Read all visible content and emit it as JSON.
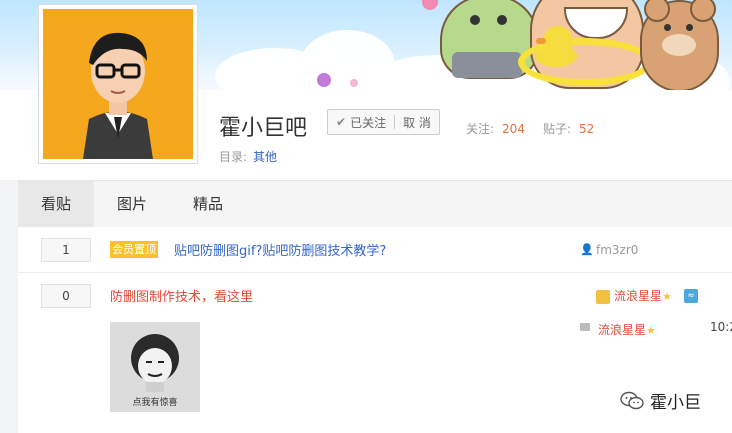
{
  "forum": {
    "name": "霍小巨吧",
    "follow_label": "已关注",
    "unfollow_label": "取 消",
    "followers_label": "关注:",
    "followers_count": "204",
    "posts_label": "贴子:",
    "posts_count": "52",
    "catalog_label": "目录:",
    "catalog_value": "其他"
  },
  "tabs": [
    {
      "label": "看贴",
      "active": true
    },
    {
      "label": "图片",
      "active": false
    },
    {
      "label": "精品",
      "active": false
    }
  ],
  "threads": [
    {
      "reply_count": "1",
      "badge": "会员置顶",
      "title": "贴吧防删图gif?贴吧防删图技术教学?",
      "author": "fm3zr0"
    },
    {
      "reply_count": "0",
      "title": "防删图制作技术，看这里",
      "author": "流浪星星",
      "last_reply_author": "流浪星星",
      "last_reply_time": "10:2",
      "image_caption": "点我有惊喜"
    }
  ],
  "watermark": {
    "text": "霍小巨"
  },
  "icons": {
    "check": "checkmark-icon",
    "user": "user-icon",
    "message": "message-icon",
    "level": "level-badge-icon",
    "star": "star-icon",
    "wechat": "wechat-icon"
  },
  "colors": {
    "link": "#3366cc",
    "highlight": "#e34a3a",
    "count": "#e4703a",
    "badge": "#f9c12a",
    "avatar_bg": "#f5a71d"
  }
}
